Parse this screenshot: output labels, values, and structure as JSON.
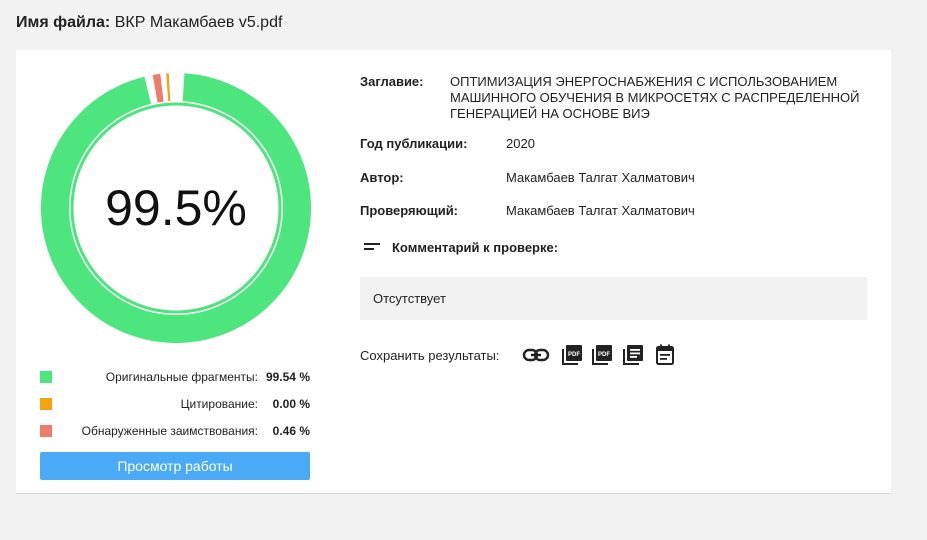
{
  "header": {
    "file_label": "Имя файла:",
    "file_name": "ВКР Макамбаев v5.pdf"
  },
  "result": {
    "percent": "99.5%",
    "original_value": 99.54,
    "citation_value": 0.0,
    "borrowed_value": 0.46,
    "colors": {
      "original": "#4de57d",
      "citation": "#f2a30f",
      "borrowed": "#ef7b6b"
    }
  },
  "legend": [
    {
      "name": "Оригинальные фрагменты:",
      "value": "99.54 %",
      "color": "#4de57d"
    },
    {
      "name": "Цитирование:",
      "value": "0.00 %",
      "color": "#f2a30f"
    },
    {
      "name": "Обнаруженные заимствования:",
      "value": "0.46 %",
      "color": "#ef7b6b"
    }
  ],
  "view_button": "Просмотр работы",
  "info": {
    "title_label": "Заглавие:",
    "title_value": "ОПТИМИЗАЦИЯ ЭНЕРГОСНАБЖЕНИЯ С ИСПОЛЬЗОВАНИЕМ МАШИННОГО ОБУЧЕНИЯ В МИКРОСЕТЯХ С РАСПРЕДЕЛЕННОЙ ГЕНЕРАЦИЕЙ НА ОСНОВЕ ВИЭ",
    "year_label": "Год публикации:",
    "year_value": "2020",
    "author_label": "Автор:",
    "author_value": "Макамбаев Талгат Халматович",
    "checker_label": "Проверяющий:",
    "checker_value": "Макамбаев Талгат Халматович",
    "comment_label": "Комментарий к проверке:",
    "comment_value": "Отсутствует"
  },
  "save": {
    "label": "Сохранить результаты:",
    "icons": [
      "link-icon",
      "pdf-icon",
      "pdf-icon",
      "report-icon",
      "calendar-icon"
    ]
  }
}
